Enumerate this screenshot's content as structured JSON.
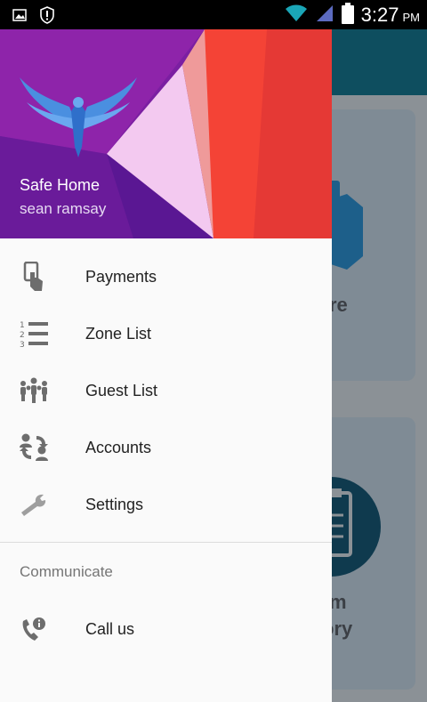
{
  "status_bar": {
    "time": "3:27",
    "ampm": "PM",
    "icons": [
      "image-icon",
      "alert-shield-icon",
      "wifi-icon",
      "cell-signal-icon",
      "battery-icon"
    ]
  },
  "drawer": {
    "header": {
      "app_name": "Safe Home",
      "user_name": "sean ramsay",
      "logo": "eagle-logo"
    },
    "menu": [
      {
        "label": "Payments",
        "icon": "card-payment-icon"
      },
      {
        "label": "Zone List",
        "icon": "numbered-list-icon"
      },
      {
        "label": "Guest List",
        "icon": "people-group-icon"
      },
      {
        "label": "Accounts",
        "icon": "accounts-switch-icon"
      },
      {
        "label": "Settings",
        "icon": "wrench-icon"
      }
    ],
    "section": {
      "title": "Communicate",
      "items": [
        {
          "label": "Call us",
          "icon": "phone-info-icon"
        }
      ]
    }
  },
  "background": {
    "card1_text": "re",
    "card2_text_line1": "m",
    "card2_text_line2": "ory"
  },
  "colors": {
    "header_purple": "#7b1fa2",
    "header_red": "#f44336",
    "drawer_bg": "#fafafa",
    "app_bar": "#0e4e5f"
  }
}
